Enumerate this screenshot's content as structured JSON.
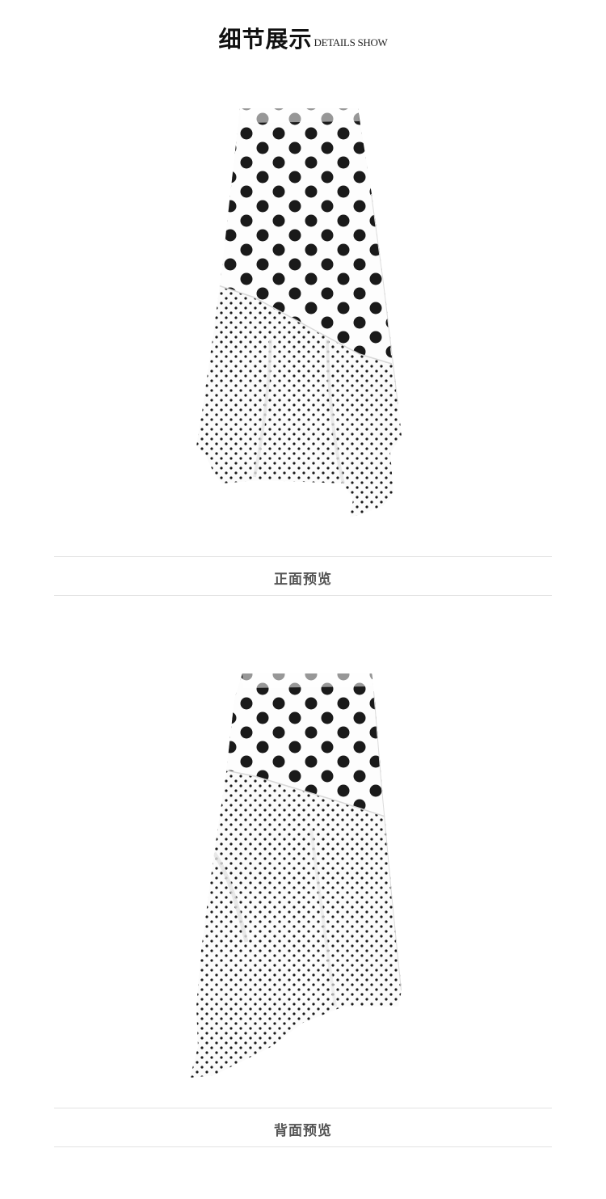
{
  "header": {
    "title_cn": "细节展示",
    "title_en": "DETAILS SHOW"
  },
  "sections": [
    {
      "caption": "正面预览"
    },
    {
      "caption": "背面预览"
    }
  ],
  "colors": {
    "background": "#ffffff",
    "divider": "#e2e2e2",
    "caption_text": "#555555",
    "dot": "#1a1a1a"
  }
}
